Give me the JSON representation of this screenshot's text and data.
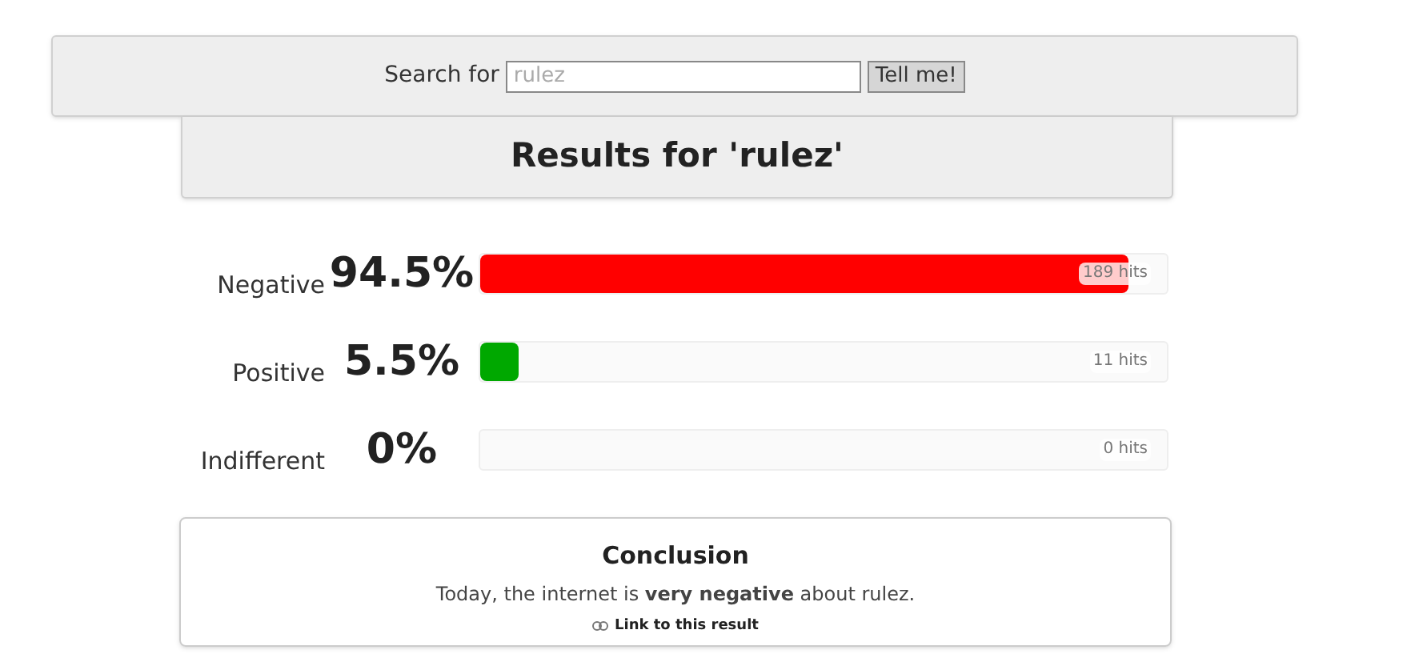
{
  "search": {
    "label": "Search for",
    "placeholder": "rulez",
    "button": "Tell me!"
  },
  "results_title": "Results for 'rulez'",
  "sentiments": [
    {
      "name": "Negative",
      "percent": "94.5%",
      "level": 0.945,
      "hits": "189 hits",
      "color": "#ff0000"
    },
    {
      "name": "Positive",
      "percent": "5.5%",
      "level": 0.055,
      "hits": "11 hits",
      "color": "#00a800"
    },
    {
      "name": "Indifferent",
      "percent": "0%",
      "hits": "0 hits"
    }
  ],
  "conclusion": {
    "title": "Conclusion",
    "text": "Today, the internet is **very negative** about rulez.",
    "link": "Link to this result"
  }
}
